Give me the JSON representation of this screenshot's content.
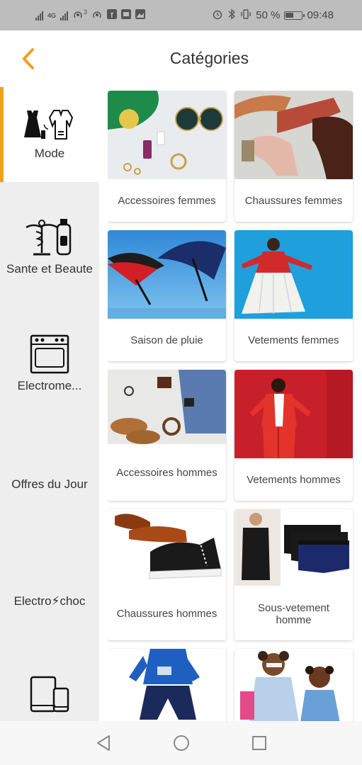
{
  "status_bar": {
    "network_badge": "3",
    "battery_percent": "50 %",
    "time": "09:48"
  },
  "header": {
    "title": "Catégories",
    "accent_color": "#f0a020"
  },
  "sidebar": {
    "items": [
      {
        "label": "Mode",
        "icon": "dress-icon",
        "active": true
      },
      {
        "label": "Sante et Beaute",
        "icon": "caduceus-icon",
        "active": false
      },
      {
        "label": "Electrome...",
        "icon": "oven-icon",
        "active": false
      },
      {
        "label": "Offres du Jour",
        "icon": "",
        "active": false
      },
      {
        "label": "Electro⚡choc",
        "icon": "",
        "active": false
      },
      {
        "label": "",
        "icon": "devices-icon",
        "active": false
      }
    ]
  },
  "categories": [
    {
      "label": "Accessoires femmes",
      "image": "women-accessories-image"
    },
    {
      "label": "Chaussures femmes",
      "image": "women-shoes-image"
    },
    {
      "label": "Saison de pluie",
      "image": "umbrellas-image"
    },
    {
      "label": "Vetements femmes",
      "image": "women-clothing-image"
    },
    {
      "label": "Accessoires hommes",
      "image": "men-accessories-image"
    },
    {
      "label": "Vetements hommes",
      "image": "men-clothing-image"
    },
    {
      "label": "Chaussures hommes",
      "image": "men-shoes-image"
    },
    {
      "label": "Sous-vetement homme",
      "image": "men-underwear-image"
    },
    {
      "label": "",
      "image": "kids-boy-clothing-image"
    },
    {
      "label": "",
      "image": "kids-girl-clothing-image"
    }
  ]
}
